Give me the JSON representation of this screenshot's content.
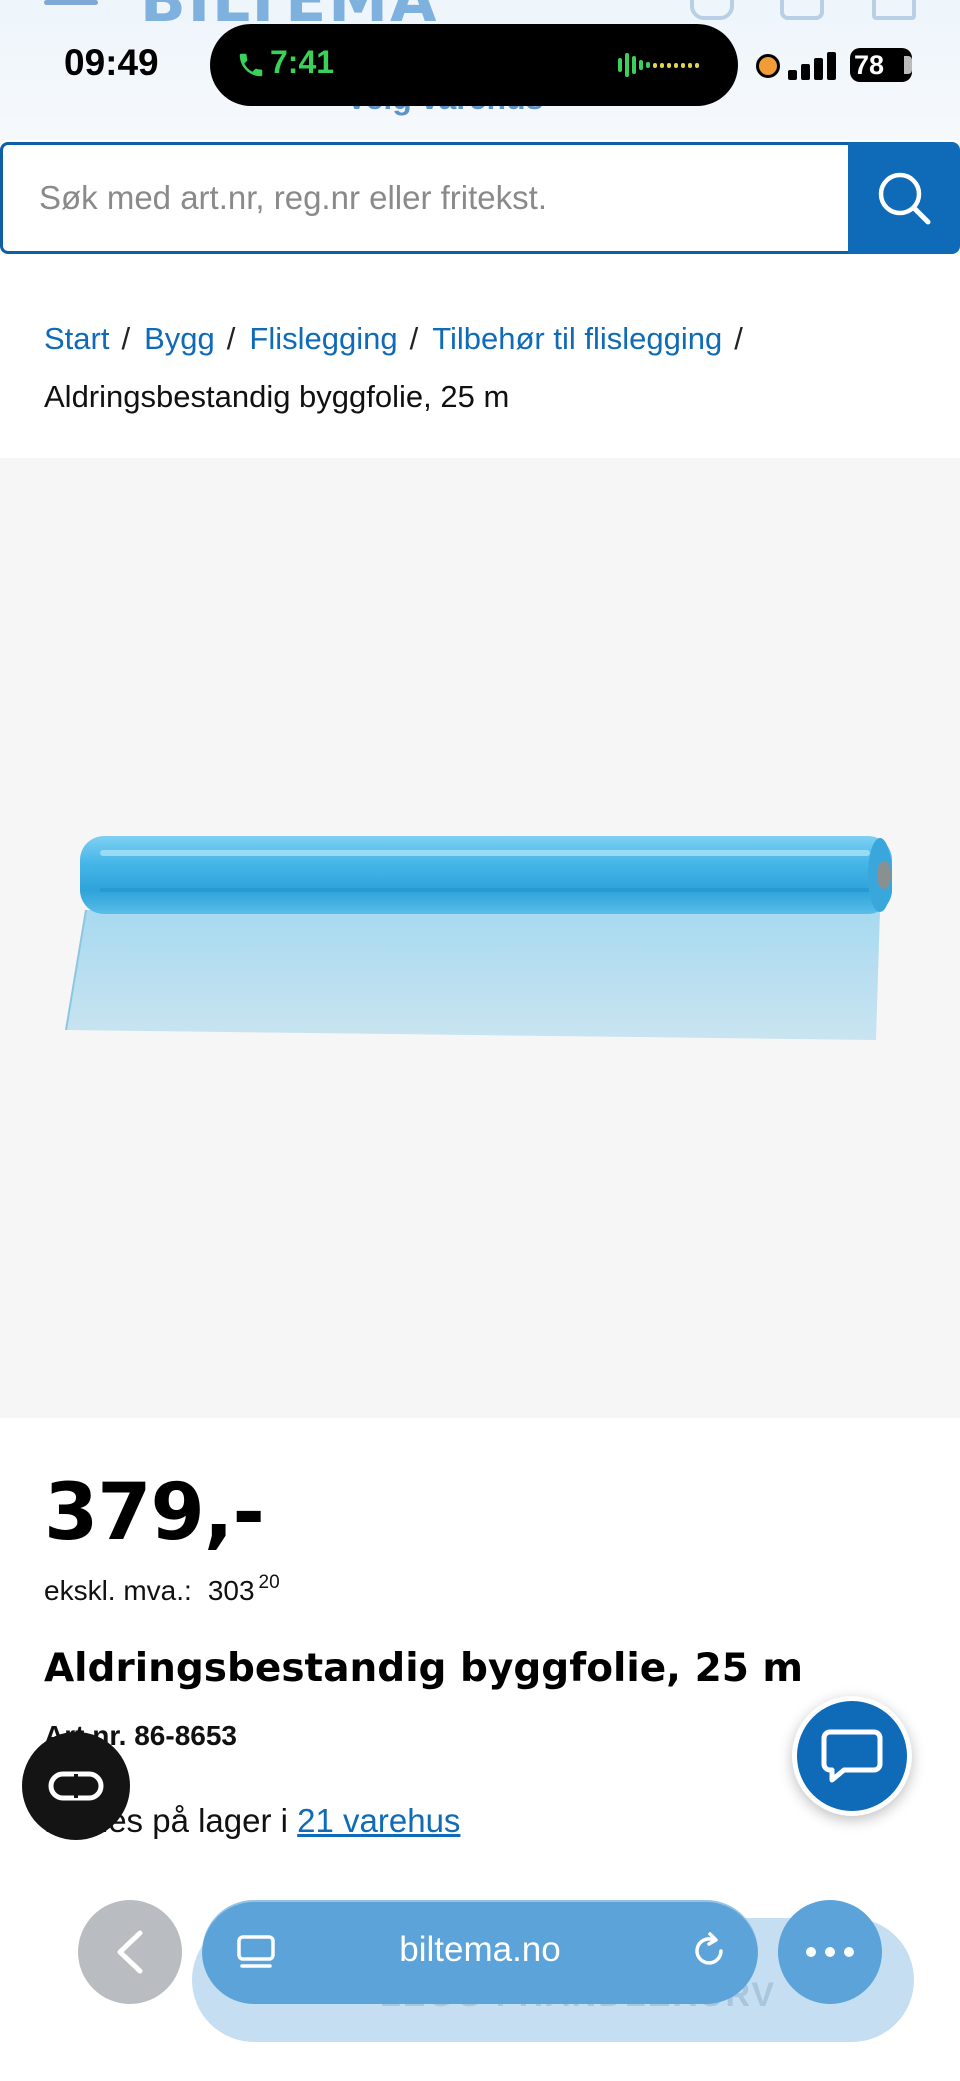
{
  "header": {
    "logo_text": "BILTEMA",
    "store_link": "Velg varehus"
  },
  "status_bar": {
    "time": "09:49",
    "call_duration": "7:41",
    "battery": "78"
  },
  "search": {
    "placeholder": "Søk med art.nr, reg.nr eller fritekst."
  },
  "breadcrumb": {
    "items": [
      "Start",
      "Bygg",
      "Flislegging",
      "Tilbehør til flislegging"
    ],
    "separator": "/",
    "current": "Aldringsbestandig byggfolie, 25 m"
  },
  "product": {
    "price": "379,-",
    "excl_vat_label": "ekskl. mva.:",
    "excl_vat_whole": "303",
    "excl_vat_decimal": "20",
    "title": "Aldringsbestandig byggfolie, 25 m",
    "article_number": "Art.nr. 86-8653",
    "stock_prefix": "Finnes på lager i",
    "stock_link": "21 varehus"
  },
  "browser": {
    "url": "biltema.no",
    "ghost_text": "LEGG I HANDLEKURV"
  },
  "colors": {
    "brand_blue": "#0f6bb8",
    "image_bg": "#f6f6f6",
    "film": "#45b6e8"
  },
  "icons": [
    "hamburger-icon",
    "phone-icon",
    "search-icon",
    "chat-icon",
    "reader-icon",
    "chevron-left-icon",
    "tabs-icon",
    "reload-icon",
    "more-icon"
  ]
}
